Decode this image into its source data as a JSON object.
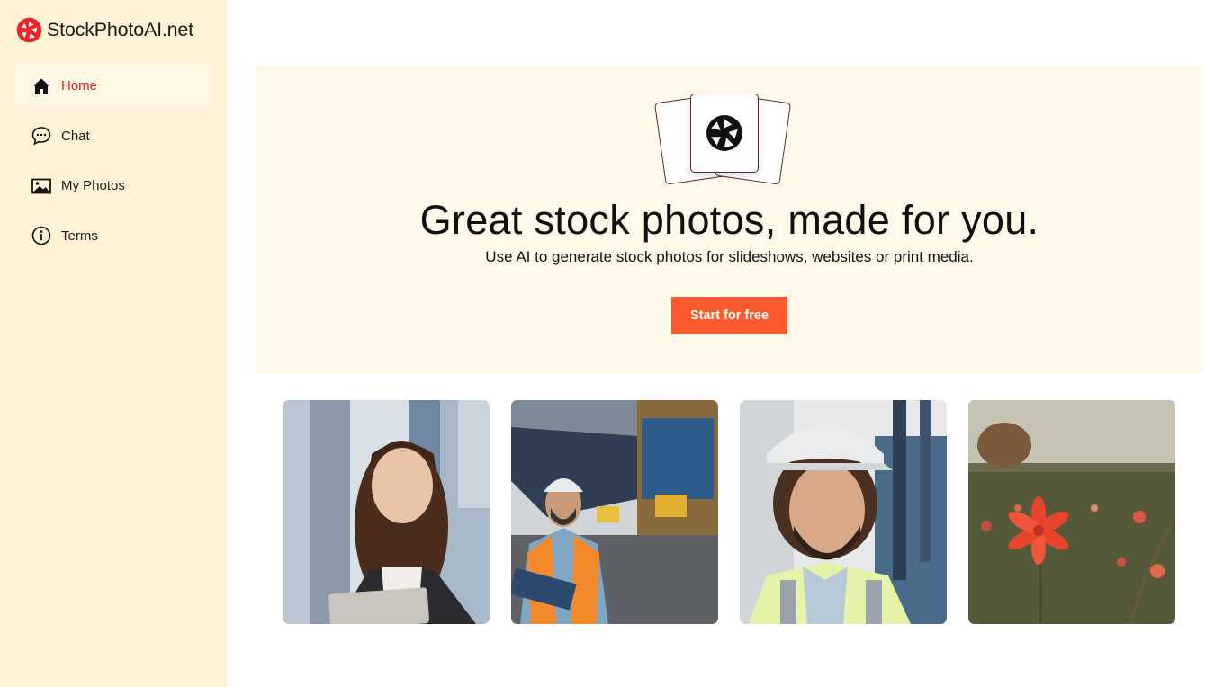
{
  "brand": {
    "name": "StockPhotoAI.net",
    "logo_icon": "aperture-logo-icon",
    "accent": "#e8262a"
  },
  "sidebar": {
    "items": [
      {
        "label": "Home",
        "icon": "home-icon",
        "active": true
      },
      {
        "label": "Chat",
        "icon": "chat-bubble-icon",
        "active": false
      },
      {
        "label": "My Photos",
        "icon": "image-icon",
        "active": false
      },
      {
        "label": "Terms",
        "icon": "info-circle-icon",
        "active": false
      }
    ]
  },
  "hero": {
    "title": "Great stock photos, made for you.",
    "subtitle": "Use AI to generate stock photos for slideshows, websites or print media.",
    "cta_label": "Start for free",
    "cta_color": "#fa5a2e",
    "illustration_icon": "aperture-icon"
  },
  "gallery": {
    "photos": [
      {
        "subject": "businesswoman-with-tablet"
      },
      {
        "subject": "port-worker-with-clipboard"
      },
      {
        "subject": "engineer-in-hard-hat"
      },
      {
        "subject": "red-flower-in-field"
      }
    ]
  },
  "colors": {
    "sidebar_bg": "#fff2d6",
    "hero_bg": "#fff9ea",
    "active_nav_text": "#e02020"
  }
}
